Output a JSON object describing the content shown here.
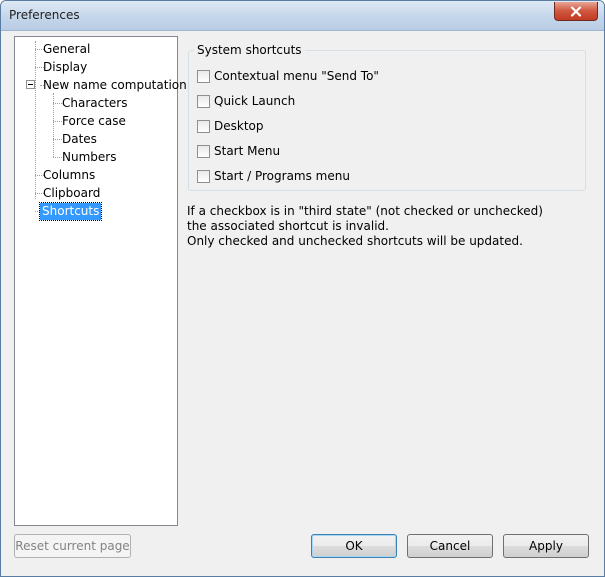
{
  "window": {
    "title": "Preferences"
  },
  "tree": {
    "items": [
      {
        "label": "General",
        "level": 0
      },
      {
        "label": "Display",
        "level": 0
      },
      {
        "label": "New name computation",
        "level": 0,
        "expanded": true
      },
      {
        "label": "Characters",
        "level": 1
      },
      {
        "label": "Force case",
        "level": 1
      },
      {
        "label": "Dates",
        "level": 1
      },
      {
        "label": "Numbers",
        "level": 1
      },
      {
        "label": "Columns",
        "level": 0
      },
      {
        "label": "Clipboard",
        "level": 0
      },
      {
        "label": "Shortcuts",
        "level": 0,
        "selected": true
      }
    ]
  },
  "shortcuts": {
    "group_title": "System shortcuts",
    "checkboxes": [
      {
        "label": "Contextual menu \"Send To\"",
        "checked": false
      },
      {
        "label": "Quick Launch",
        "checked": false
      },
      {
        "label": "Desktop",
        "checked": false
      },
      {
        "label": "Start Menu",
        "checked": false
      },
      {
        "label": "Start / Programs menu",
        "checked": false
      }
    ],
    "info_lines": [
      "If a checkbox is in \"third state\" (not checked or unchecked)",
      "the associated shortcut is invalid.",
      "Only checked and unchecked shortcuts will be updated."
    ]
  },
  "buttons": {
    "reset": "Reset current page",
    "ok": "OK",
    "cancel": "Cancel",
    "apply": "Apply"
  },
  "colors": {
    "selection": "#3399ff",
    "close_button": "#c23a22"
  }
}
